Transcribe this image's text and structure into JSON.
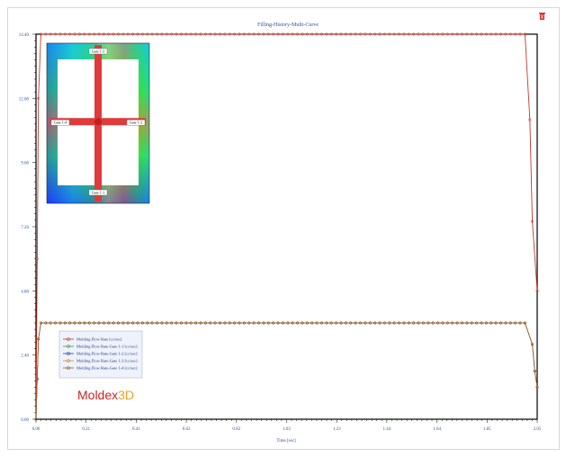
{
  "chart_data": {
    "type": "line",
    "title": "Filling-History-Multi-Curve",
    "xlabel": "Time [sec]",
    "ylabel": "",
    "xlim": [
      0.0,
      2.05
    ],
    "ylim": [
      0.0,
      14.4
    ],
    "xticks": [
      "0.00",
      "0.21",
      "0.41",
      "0.62",
      "0.82",
      "1.03",
      "1.23",
      "1.44",
      "1.64",
      "1.85",
      "2.05"
    ],
    "yticks": [
      "0.00",
      "2.40",
      "4.80",
      "7.20",
      "9.60",
      "12.00",
      "14.40"
    ],
    "grid": false,
    "legend_position": "bottom-left",
    "series": [
      {
        "name": "Molding Flow Rate [cc/sec]",
        "color": "#c0392b",
        "x": [
          0.0,
          0.005,
          0.01,
          0.02,
          2.0,
          2.02,
          2.03,
          2.05
        ],
        "y": [
          0.0,
          6.0,
          12.0,
          14.4,
          14.4,
          11.2,
          7.4,
          4.8
        ]
      },
      {
        "name": "Molding Flow Rate-Gate 1-1 [cc/sec]",
        "color": "#3a9a3a",
        "x": [
          0.0,
          0.005,
          0.01,
          0.02,
          2.0,
          2.03,
          2.04,
          2.05
        ],
        "y": [
          0.0,
          1.5,
          3.0,
          3.6,
          3.6,
          2.8,
          1.8,
          1.2
        ]
      },
      {
        "name": "Molding Flow Rate-Gate 1-2 [cc/sec]",
        "color": "#2c3e9e",
        "x": [
          0.0,
          0.005,
          0.01,
          0.02,
          2.0,
          2.03,
          2.04,
          2.05
        ],
        "y": [
          0.0,
          1.5,
          3.0,
          3.6,
          3.6,
          2.8,
          1.8,
          1.2
        ]
      },
      {
        "name": "Molding Flow Rate-Gate 1-3 [cc/sec]",
        "color": "#e67e22",
        "x": [
          0.0,
          0.005,
          0.01,
          0.02,
          2.0,
          2.03,
          2.04,
          2.05
        ],
        "y": [
          0.0,
          1.5,
          3.0,
          3.6,
          3.6,
          2.8,
          1.8,
          1.2
        ]
      },
      {
        "name": "Molding Flow Rate-Gate 1-4 [cc/sec]",
        "color": "#8e5a2a",
        "x": [
          0.0,
          0.005,
          0.01,
          0.02,
          2.0,
          2.03,
          2.04,
          2.05
        ],
        "y": [
          0.0,
          1.5,
          3.0,
          3.6,
          3.6,
          2.8,
          1.8,
          1.2
        ]
      }
    ],
    "inset": {
      "gate_labels": [
        "Gate 1-3",
        "Gate 1-4",
        "Gate 1-2",
        "Gate 1-1"
      ]
    },
    "logo": {
      "part1": "Moldex",
      "part2": "3D"
    }
  },
  "icons": {
    "close": "close-icon"
  }
}
